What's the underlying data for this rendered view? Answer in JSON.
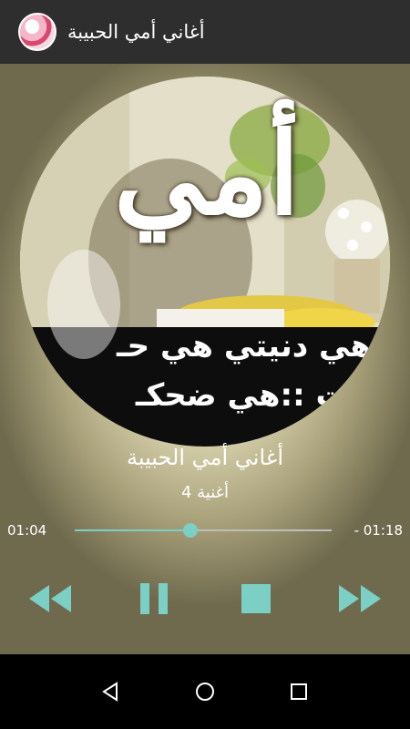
{
  "app": {
    "title": "أغاني أمي الحبيبة",
    "icon": "app-logo-icon"
  },
  "album_art": {
    "word": "أمي",
    "line1": "هي دنيتي هي حـ",
    "line2": "ـلت ::هي ضحكـ"
  },
  "now_playing": {
    "title": "أغاني أمي الحبيبة",
    "subtitle": "أغنية 4"
  },
  "progress": {
    "elapsed": "01:04",
    "remaining": "- 01:18",
    "fraction": 0.45
  },
  "controls": {
    "rewind": "rewind-icon",
    "pause": "pause-icon",
    "stop": "stop-icon",
    "fast_forward": "fast-forward-icon"
  },
  "navbar": {
    "back": "back-icon",
    "home": "home-icon",
    "recents": "recents-icon"
  },
  "colors": {
    "accent": "#7ccfc4",
    "appbar": "#2e2e2e"
  }
}
